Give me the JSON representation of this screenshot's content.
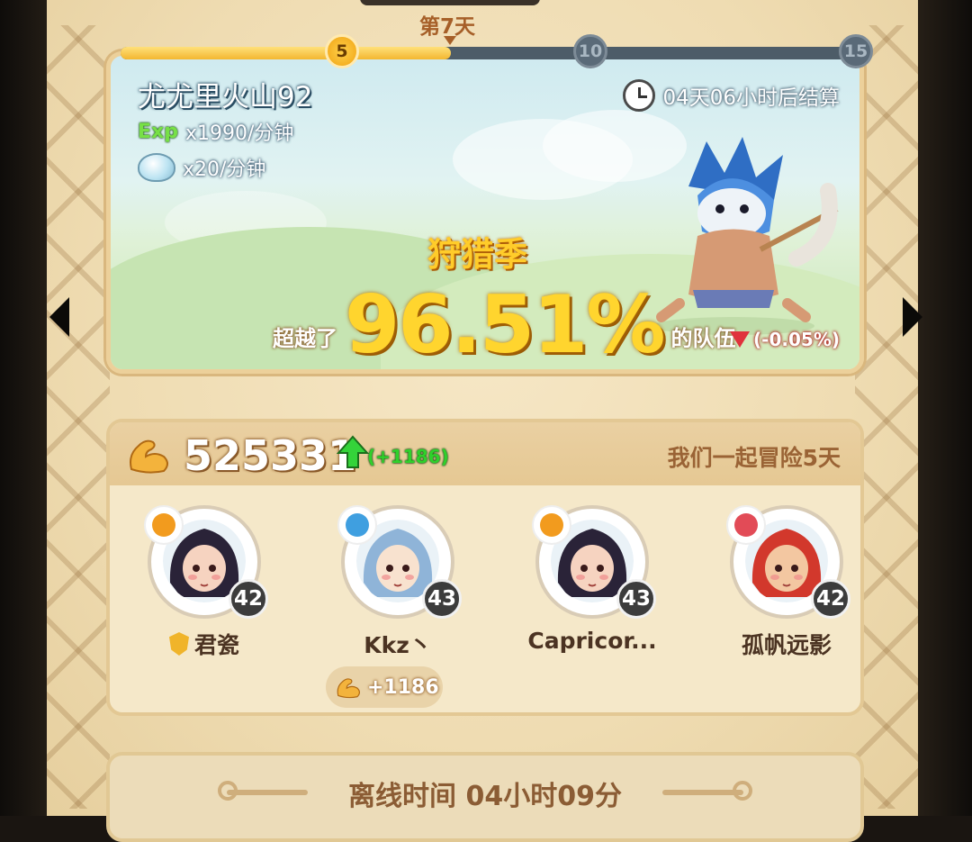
{
  "progress": {
    "day_label": "第7天",
    "fill_fraction": 0.45,
    "milestones": [
      {
        "label": "5",
        "state": "done"
      },
      {
        "label": "10",
        "state": "todo"
      },
      {
        "label": "15",
        "state": "todo"
      }
    ]
  },
  "banner": {
    "zone_title": "尤尤里火山92",
    "exp_rate": "x1990/分钟",
    "shell_rate": "x20/分钟",
    "timer_text": "04天06小时后结算",
    "season_title": "狩猎季",
    "surpass_pre": "超越了",
    "percent": "96.51%",
    "surpass_post": "的队伍",
    "change": "(-0.05%)"
  },
  "team": {
    "power": "525331",
    "power_delta": "(+1186)",
    "adventure_text": "我们一起冒险5天",
    "members": [
      {
        "name": "君瓷",
        "level": "42",
        "role_color": "#f29b1e",
        "hair": "#2a2338",
        "skin": "#f6d3c0",
        "leader": true
      },
      {
        "name": "Kkz丶",
        "level": "43",
        "role_color": "#3f9fe0",
        "hair": "#8fb4d8",
        "skin": "#f8e2cf",
        "leader": false
      },
      {
        "name": "Capricor...",
        "level": "43",
        "role_color": "#f29b1e",
        "hair": "#2a2338",
        "skin": "#f6d3c0",
        "leader": false
      },
      {
        "name": "孤帆远影",
        "level": "42",
        "role_color": "#e24b57",
        "hair": "#d2382c",
        "skin": "#f3c7a1",
        "leader": false
      }
    ],
    "contribution": "+1186"
  },
  "offline": {
    "text": "离线时间 04小时09分"
  },
  "colors": {
    "gold": "#ffd52e",
    "green_up": "#2fd02b",
    "red_down": "#e0323c"
  }
}
